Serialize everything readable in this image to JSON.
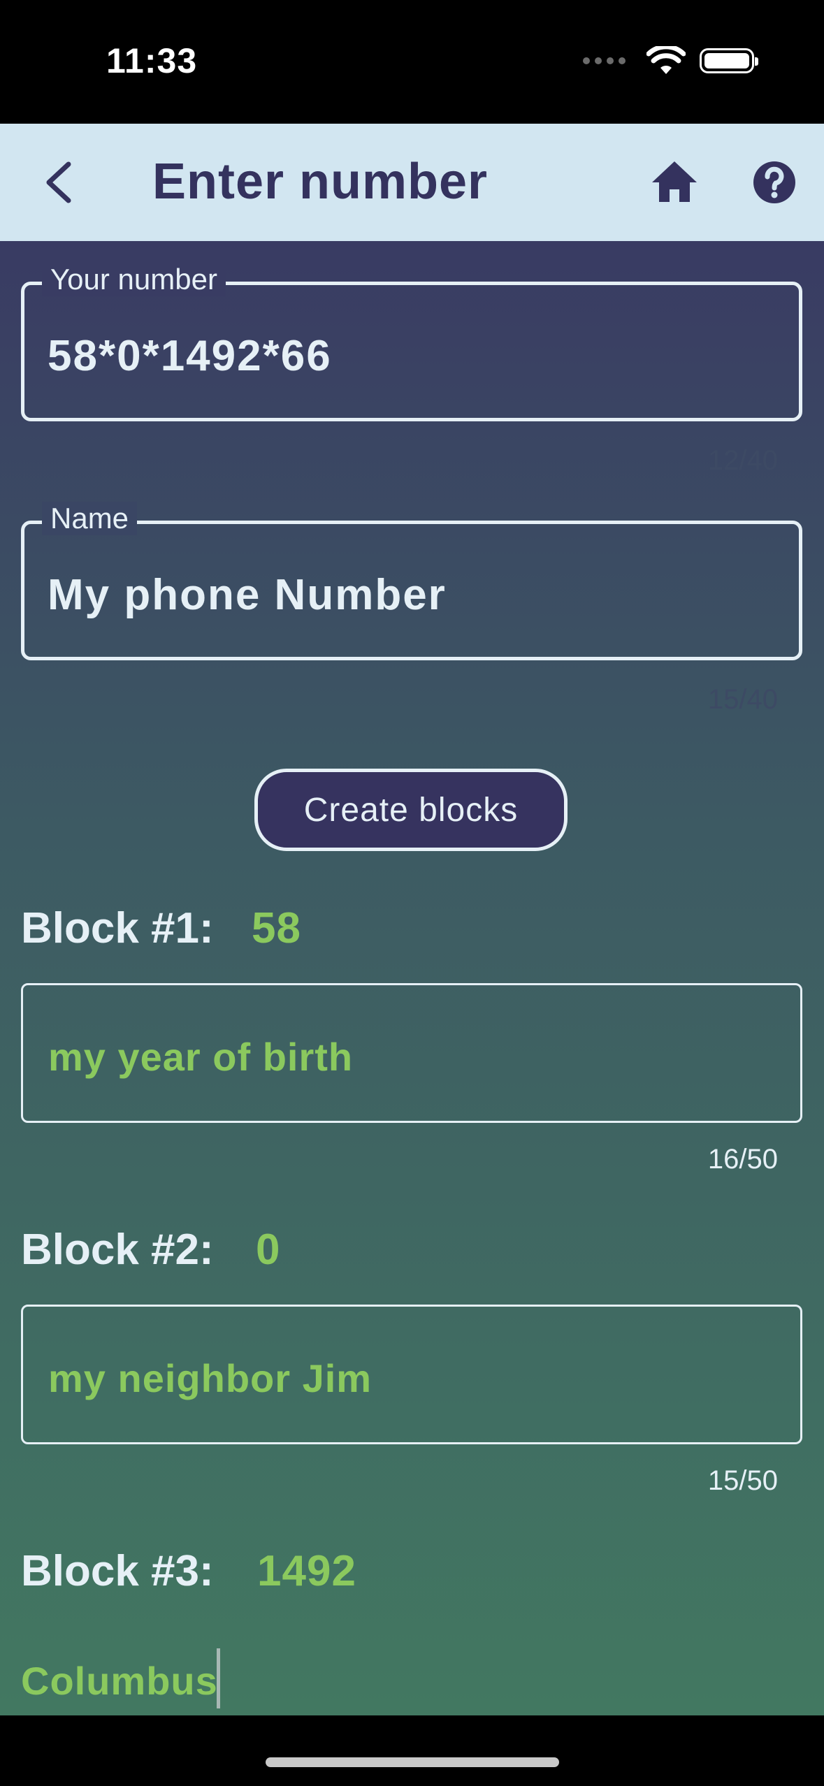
{
  "status_bar": {
    "time": "11:33"
  },
  "app_bar": {
    "title": "Enter number"
  },
  "form": {
    "number": {
      "label": "Your number",
      "value": "58*0*1492*66",
      "counter": "12/40"
    },
    "name": {
      "label": "Name",
      "value": "My phone Number",
      "counter": "15/40"
    },
    "create_button": "Create blocks"
  },
  "blocks": [
    {
      "label": "Block #1:",
      "value": "58",
      "description": "my year of birth",
      "counter": "16/50"
    },
    {
      "label": "Block #2:",
      "value": "0",
      "description": "my neighbor Jim",
      "counter": "15/50"
    },
    {
      "label": "Block #3:",
      "value": "1492",
      "description": "Columbus"
    }
  ],
  "colors": {
    "app_bar_bg": "#d2e6f1",
    "title": "#34325e",
    "accent_green": "#8bc95e",
    "text_light": "#e6f0f6",
    "button_bg": "#36335f"
  }
}
